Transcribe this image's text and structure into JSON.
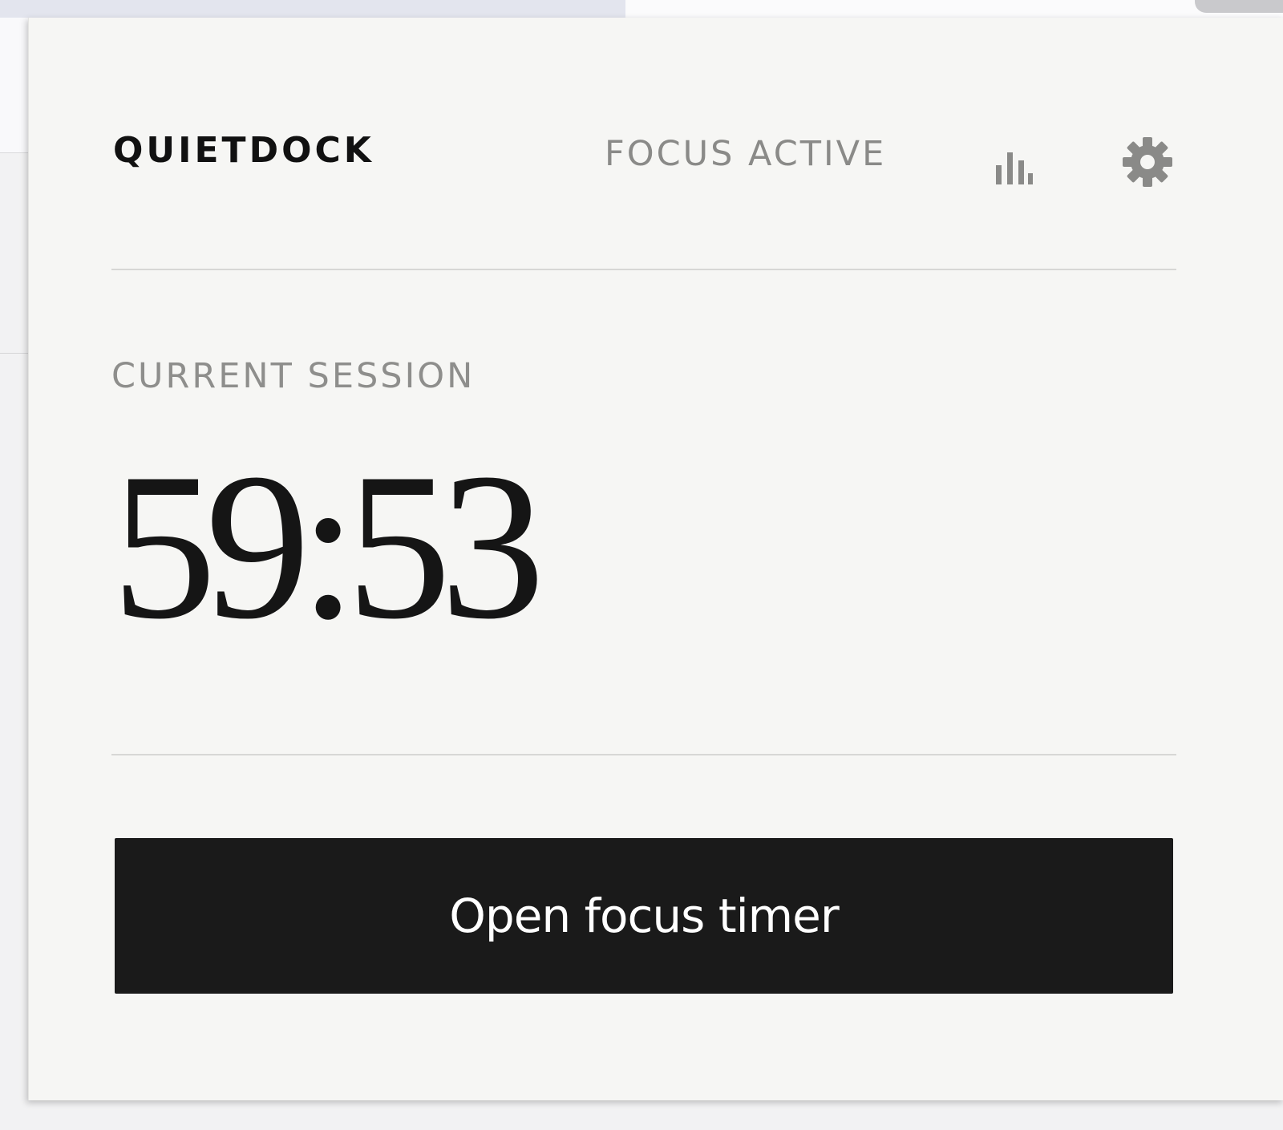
{
  "popup": {
    "brand": "QUIETDOCK",
    "status": "FOCUS ACTIVE",
    "stats_icon": "bar-chart-icon",
    "settings_icon": "gear-icon",
    "session_label": "CURRENT SESSION",
    "timer_value": "59:53",
    "cta_label": "Open focus timer"
  },
  "colors": {
    "panel_background": "#f6f6f4",
    "brand_text": "#111111",
    "muted_text": "#8a8a88",
    "button_background": "#1a1a1a",
    "button_text": "#ffffff",
    "divider": "#d7d7d5"
  }
}
